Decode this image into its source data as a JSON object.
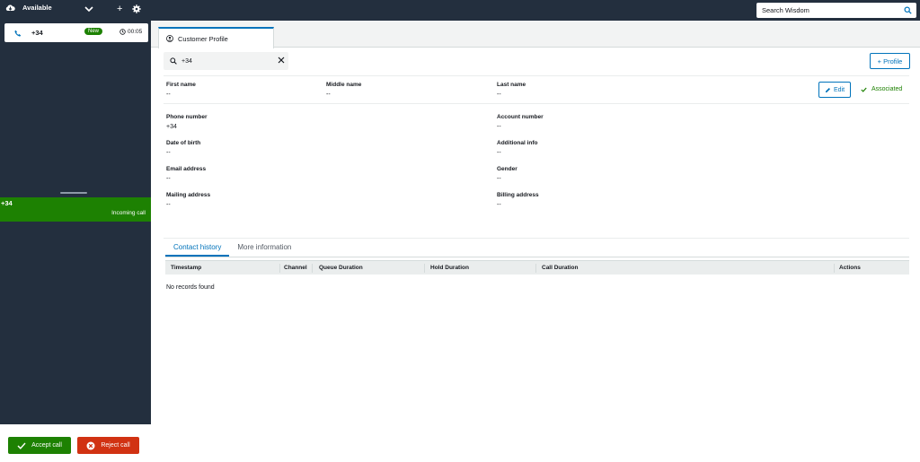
{
  "topbar": {
    "status_label": "Available",
    "search_placeholder": "Search Wisdom"
  },
  "contact_card": {
    "number": "+34",
    "badge": "New",
    "timer": "00:05"
  },
  "incoming": {
    "number": "+34",
    "label": "Incoming call"
  },
  "call_actions": {
    "accept_label": "Accept call",
    "reject_label": "Reject call"
  },
  "profile_tab": {
    "label": "Customer Profile"
  },
  "profile_search": {
    "value": "+34"
  },
  "add_profile_label": "+ Profile",
  "edit_label": "Edit",
  "associated_label": "Associated",
  "fields": {
    "first_name": {
      "label": "First name",
      "value": "--"
    },
    "middle_name": {
      "label": "Middle name",
      "value": "--"
    },
    "last_name": {
      "label": "Last name",
      "value": "--"
    },
    "phone_number": {
      "label": "Phone number",
      "value": "+34"
    },
    "account_number": {
      "label": "Account number",
      "value": "--"
    },
    "date_of_birth": {
      "label": "Date of birth",
      "value": "--"
    },
    "additional_info": {
      "label": "Additional info",
      "value": "--"
    },
    "email_address": {
      "label": "Email address",
      "value": "--"
    },
    "gender": {
      "label": "Gender",
      "value": "--"
    },
    "mailing_address": {
      "label": "Mailing address",
      "value": "--"
    },
    "billing_address": {
      "label": "Billing address",
      "value": "--"
    }
  },
  "history_tabs": {
    "contact_history": "Contact history",
    "more_information": "More information"
  },
  "table": {
    "columns": {
      "timestamp": "Timestamp",
      "channel": "Channel",
      "queue_duration": "Queue Duration",
      "hold_duration": "Hold Duration",
      "call_duration": "Call Duration",
      "actions": "Actions"
    },
    "empty_text": "No records found"
  },
  "colors": {
    "topbar_bg": "#232f3e",
    "accept_green": "#1d8102",
    "reject_red": "#d13212",
    "link_blue": "#0073bb"
  },
  "icons": [
    "cloud-icon",
    "chevron-down-icon",
    "plus-icon",
    "gear-icon",
    "search-icon",
    "phone-icon",
    "clock-icon",
    "user-icon",
    "close-icon",
    "pencil-icon",
    "check-icon",
    "x-circle-icon"
  ]
}
